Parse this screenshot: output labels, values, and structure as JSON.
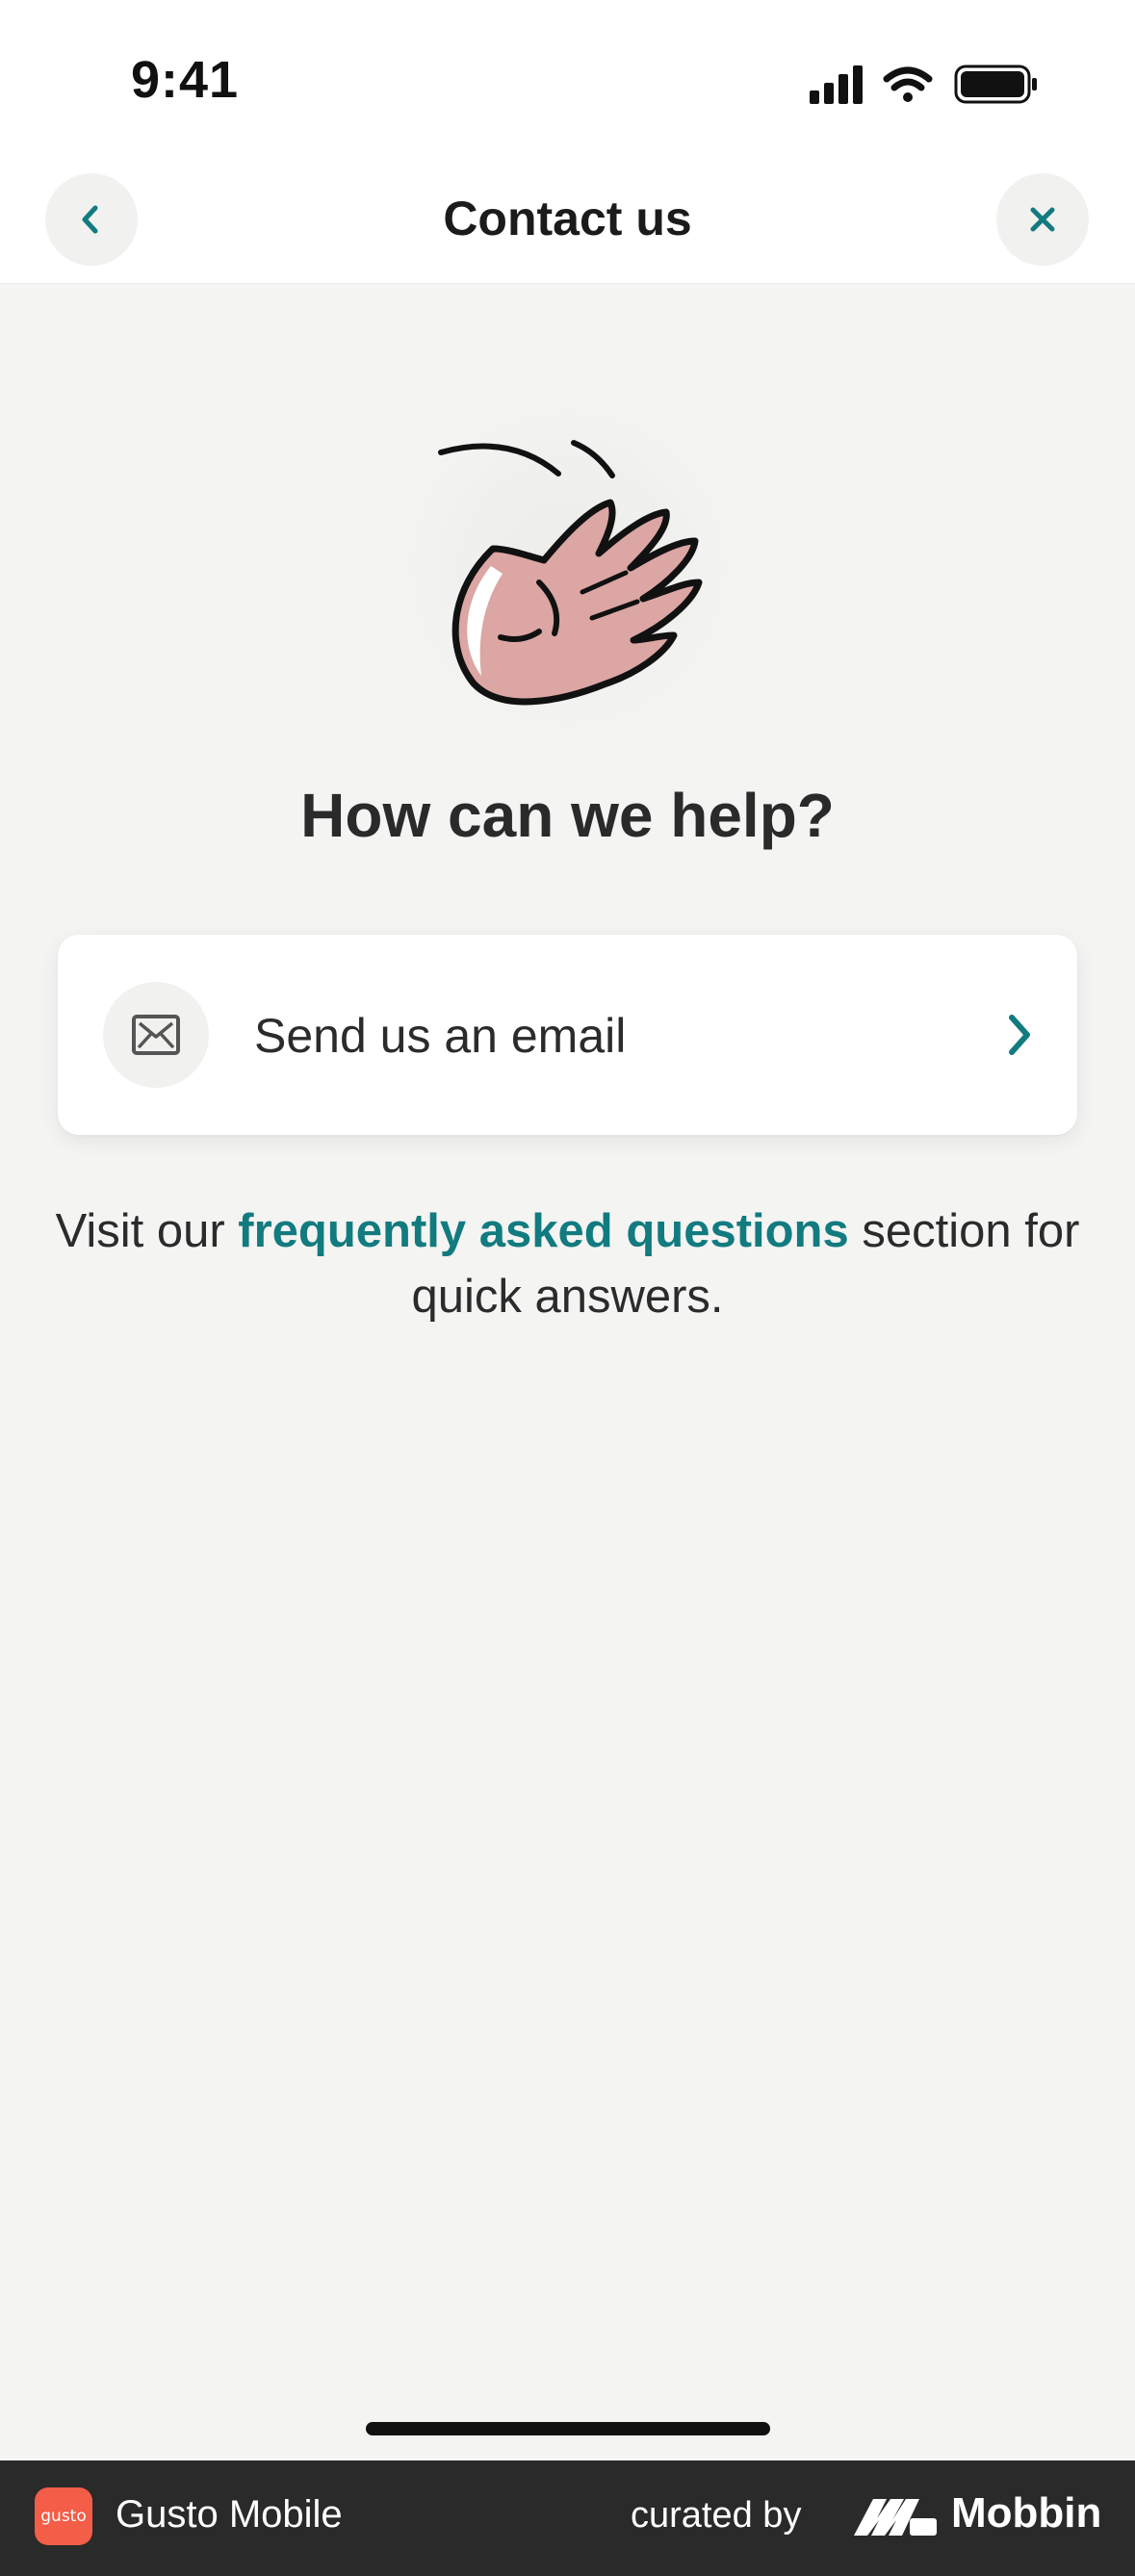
{
  "status_bar": {
    "time": "9:41",
    "icons": [
      "cellular-signal-icon",
      "wifi-icon",
      "battery-icon"
    ]
  },
  "nav": {
    "title": "Contact us",
    "back_icon": "chevron-left-icon",
    "close_icon": "close-icon"
  },
  "hero": {
    "illustration": "waving-hand-icon"
  },
  "heading": "How can we help?",
  "email_option": {
    "label": "Send us an email",
    "icon": "envelope-icon",
    "trailing_icon": "chevron-right-icon"
  },
  "faq": {
    "prefix": "Visit our ",
    "link_text": "frequently asked questions",
    "suffix": " section for quick answers."
  },
  "footer": {
    "app_icon_text": "gusto",
    "app_name": "Gusto Mobile",
    "curated_by": "curated by",
    "brand": "Mobbin"
  },
  "colors": {
    "accent": "#127b7f",
    "background": "#f4f4f3",
    "card": "#ffffff",
    "footer_bg": "#2a2a2a",
    "app_icon": "#f45d48",
    "hand_fill": "#dba6a3"
  }
}
